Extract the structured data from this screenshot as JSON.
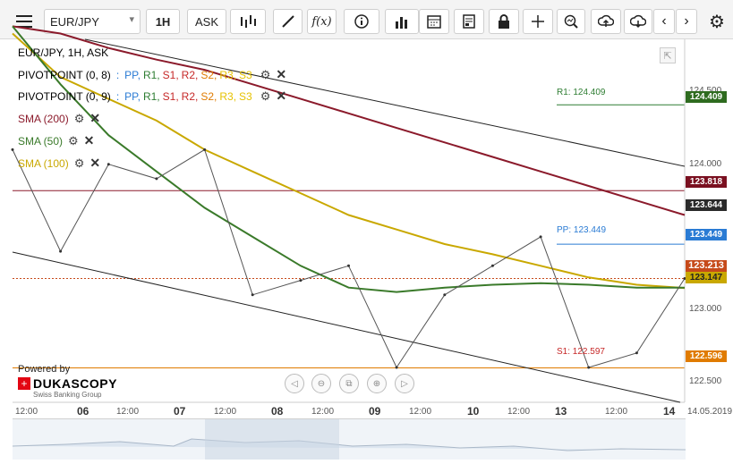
{
  "toolbar": {
    "symbol": "EUR/JPY",
    "interval": "1H",
    "side": "ASK",
    "buttons": [
      "menu-icon",
      "bar-type-icon",
      "draw-icon",
      "fx-icon",
      "info-icon",
      "volume-icon",
      "calendar-icon",
      "report-icon",
      "lock-icon",
      "crosshair-icon",
      "zoom-icon",
      "upload-icon",
      "download-icon",
      "prev-icon",
      "next-icon",
      "settings-icon"
    ]
  },
  "legend": {
    "title": "EUR/JPY, 1H, ASK",
    "pivot1_label": "PIVOTPOINT (0, 8)",
    "pivot2_label": "PIVOTPOINT (0, 9)",
    "pivot_series": [
      {
        "name": "PP",
        "color": "#2a7bd4"
      },
      {
        "name": "R1",
        "color": "#2e7d32"
      },
      {
        "name": "S1",
        "color": "#c62828"
      },
      {
        "name": "R2",
        "color": "#c62828"
      },
      {
        "name": "S2",
        "color": "#e07b00"
      },
      {
        "name": "R3",
        "color": "#e6c200"
      },
      {
        "name": "S3",
        "color": "#e6c200"
      }
    ],
    "sma200": "SMA (200)",
    "sma50": "SMA (50)",
    "sma100": "SMA (100)",
    "colors": {
      "sma200": "#8b1a2b",
      "sma50": "#3a7a2a",
      "sma100": "#c9a800"
    }
  },
  "branding": {
    "powered_by": "Powered by",
    "name": "DUKASCOPY",
    "tagline": "Swiss Banking Group"
  },
  "price_boxes": {
    "r1": "124.409",
    "sma200": "123.818",
    "upper_band": "123.644",
    "pp": "123.449",
    "last": "123.213",
    "sma100": "123.147",
    "s1": "122.596"
  },
  "line_labels": {
    "r1": "R1: 124.409",
    "pp": "PP: 123.449",
    "s1": "S1: 122.597"
  },
  "chart_data": {
    "type": "line",
    "title": "EUR/JPY, 1H, ASK",
    "yticks": [
      "124.500",
      "124.000",
      "123.500",
      "123.000",
      "122.500"
    ],
    "ylim": [
      122.36,
      124.86
    ],
    "xticks": [
      "12:00",
      "06",
      "12:00",
      "07",
      "12:00",
      "08",
      "12:00",
      "09",
      "12:00",
      "10",
      "12:00",
      "13",
      "12:00",
      "14",
      "14.05.2019"
    ],
    "grid": false,
    "levels": {
      "R1": 124.409,
      "PP": 123.449,
      "S1": 122.597,
      "SMA200_level": 123.818
    },
    "series": [
      {
        "name": "SMA (200)",
        "values": [
          124.95,
          124.9,
          124.8,
          124.72,
          124.65,
          124.55,
          124.45,
          124.35,
          124.25,
          124.15,
          124.05,
          123.95,
          123.85,
          123.75,
          123.65
        ]
      },
      {
        "name": "SMA (100)",
        "values": [
          124.9,
          124.6,
          124.45,
          124.3,
          124.1,
          123.95,
          123.8,
          123.65,
          123.55,
          123.45,
          123.38,
          123.3,
          123.22,
          123.17,
          123.147
        ]
      },
      {
        "name": "SMA (50)",
        "values": [
          124.95,
          124.55,
          124.2,
          123.95,
          123.7,
          123.5,
          123.3,
          123.15,
          123.12,
          123.15,
          123.17,
          123.18,
          123.17,
          123.15,
          123.15
        ]
      },
      {
        "name": "EUR/JPY",
        "values": [
          124.1,
          123.4,
          124.0,
          123.9,
          124.1,
          123.1,
          123.2,
          123.3,
          122.6,
          123.1,
          123.3,
          123.5,
          122.6,
          122.7,
          123.213
        ]
      }
    ]
  }
}
